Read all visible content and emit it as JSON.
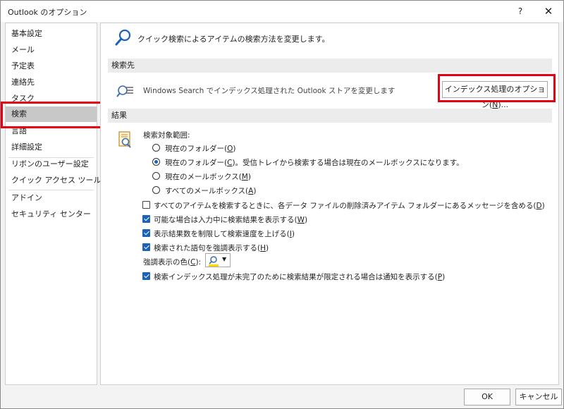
{
  "window": {
    "title": "Outlook のオプション",
    "help_label": "?",
    "close_label": "✕"
  },
  "sidebar": {
    "items": [
      {
        "label": "基本設定"
      },
      {
        "label": "メール"
      },
      {
        "label": "予定表"
      },
      {
        "label": "連絡先"
      },
      {
        "label": "タスク"
      },
      {
        "label": "検索",
        "selected": true
      },
      {
        "label": "言語"
      },
      {
        "label": "詳細設定"
      },
      {
        "label": "リボンのユーザー設定"
      },
      {
        "label": "クイック アクセス ツール バー"
      },
      {
        "label": "アドイン"
      },
      {
        "label": "セキュリティ センター"
      }
    ]
  },
  "main": {
    "intro": "クイック検索によるアイテムの検索方法を変更します。",
    "sources_header": "検索先",
    "sources_text": "Windows Search でインデックス処理された Outlook ストアを変更します",
    "index_button": {
      "text": "インデックス処理のオプション(",
      "key": "N",
      "suffix": ")..."
    },
    "results_header": "結果",
    "scope_label": "検索対象範囲:",
    "radios": [
      {
        "text": "現在のフォルダー(",
        "key": "O",
        "suffix": ")",
        "checked": false
      },
      {
        "text": "現在のフォルダー(",
        "key": "C",
        "suffix": ")。受信トレイから検索する場合は現在のメールボックスになります。",
        "checked": true
      },
      {
        "text": "現在のメールボックス(",
        "key": "M",
        "suffix": ")",
        "checked": false
      },
      {
        "text": "すべてのメールボックス(",
        "key": "A",
        "suffix": ")",
        "checked": false
      }
    ],
    "checkboxes": [
      {
        "text": "すべてのアイテムを検索するときに、各データ ファイルの削除済みアイテム フォルダーにあるメッセージを含める(",
        "key": "D",
        "suffix": ")",
        "checked": false
      },
      {
        "text": "可能な場合は入力中に検索結果を表示する(",
        "key": "W",
        "suffix": ")",
        "checked": true
      },
      {
        "text": "表示結果数を制限して検索速度を上げる(",
        "key": "I",
        "suffix": ")",
        "checked": true
      },
      {
        "text": "検索された語句を強調表示する(",
        "key": "H",
        "suffix": ")",
        "checked": true
      }
    ],
    "highlight_color": {
      "text": "強調表示の色(",
      "key": "C",
      "suffix": "):",
      "swatch": "#ffd700"
    },
    "notify_checkbox": {
      "text": "検索インデックス処理が未完了のために検索結果が限定される場合は通知を表示する(",
      "key": "P",
      "suffix": ")",
      "checked": true
    }
  },
  "footer": {
    "ok_label": "OK",
    "cancel_label": "キャンセル"
  },
  "colors": {
    "accent": "#1c62b9",
    "highlight_red": "#e60012",
    "selected_bg": "#c8c8c8"
  }
}
